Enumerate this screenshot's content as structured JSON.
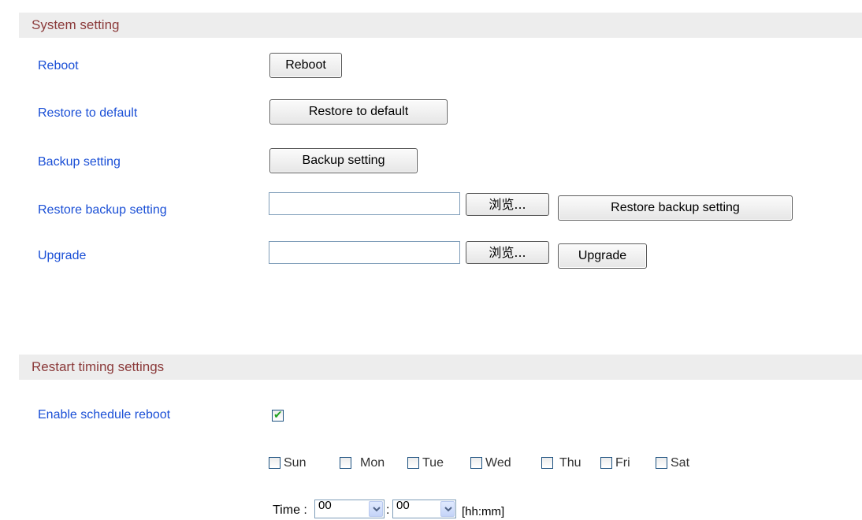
{
  "system_section": {
    "title": "System setting",
    "reboot": {
      "label": "Reboot",
      "button": "Reboot"
    },
    "restore_default": {
      "label": "Restore to default",
      "button": "Restore to default"
    },
    "backup": {
      "label": "Backup setting",
      "button": "Backup setting"
    },
    "restore_backup": {
      "label": "Restore backup setting",
      "file_value": "",
      "browse": "浏览...",
      "button": "Restore backup setting"
    },
    "upgrade": {
      "label": "Upgrade",
      "file_value": "",
      "browse": "浏览...",
      "button": "Upgrade"
    }
  },
  "restart_section": {
    "title": "Restart timing settings",
    "enable": {
      "label": "Enable schedule reboot",
      "checked": true
    },
    "days": [
      {
        "label": "Sun",
        "checked": false
      },
      {
        "label": "Mon",
        "checked": false
      },
      {
        "label": "Tue",
        "checked": false
      },
      {
        "label": "Wed",
        "checked": false
      },
      {
        "label": "Thu",
        "checked": false
      },
      {
        "label": "Fri",
        "checked": false
      },
      {
        "label": "Sat",
        "checked": false
      }
    ],
    "time": {
      "label": "Time :",
      "hour": "00",
      "separator": ":",
      "minute": "00",
      "format": "[hh:mm]"
    }
  },
  "colors": {
    "section_title": "#8b3a3a",
    "row_label": "#1a4fd6",
    "header_bg": "#ededed",
    "check_mark": "#21a121"
  }
}
